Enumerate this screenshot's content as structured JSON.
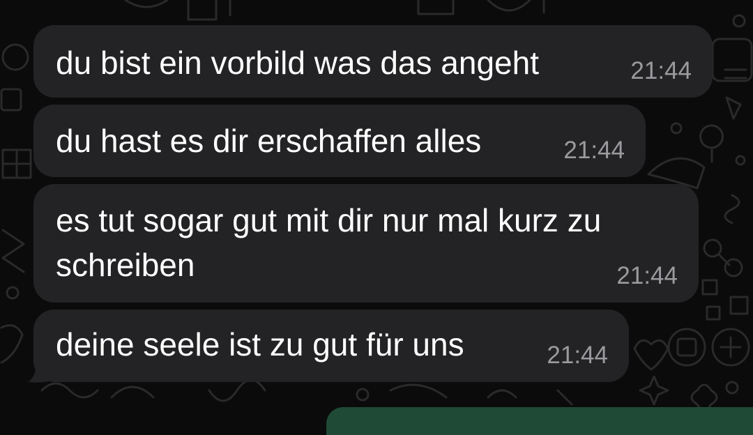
{
  "messages": [
    {
      "text": "du bist ein vorbild was das angeht",
      "time": "21:44"
    },
    {
      "text": "du hast es dir erschaffen alles",
      "time": "21:44"
    },
    {
      "text": "es tut sogar gut mit dir nur mal kurz zu schreiben",
      "time": "21:44"
    },
    {
      "text": "deine seele ist zu gut für uns",
      "time": "21:44"
    }
  ],
  "colors": {
    "background": "#0b0b0b",
    "incoming_bubble": "#232325",
    "message_text": "#ffffff",
    "timestamp_text": "#9b9b9f",
    "outgoing_bubble": "#1f4a35"
  }
}
